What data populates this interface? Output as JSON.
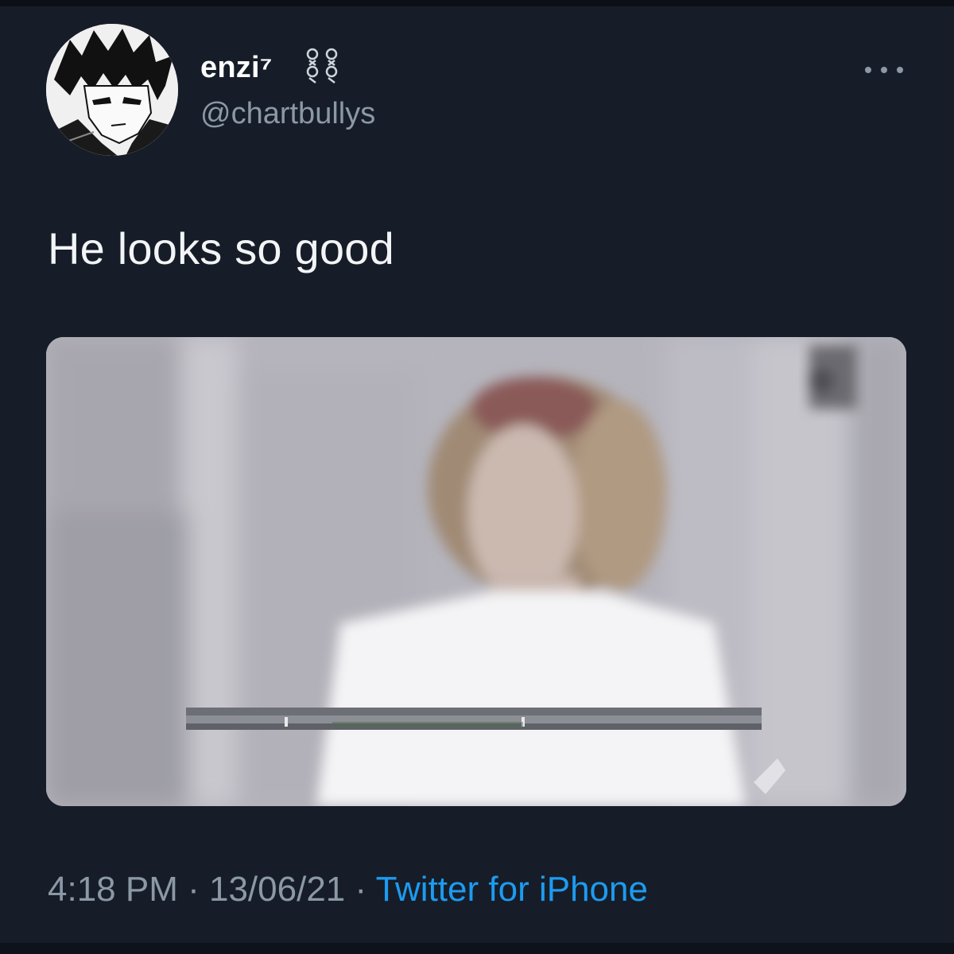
{
  "author": {
    "display_name": "enzi⁷",
    "handle": "@chartbullys",
    "avatar_icon": "anime-avatar",
    "name_badge_icon": "chain-icon"
  },
  "tweet": {
    "text": "He looks so good"
  },
  "media": {
    "kind": "video-thumbnail"
  },
  "meta": {
    "time": "4:18 PM",
    "separator": " · ",
    "date": "13/06/21",
    "source": "Twitter for iPhone"
  },
  "actions": {
    "more_icon": "more-icon"
  },
  "colors": {
    "background": "#161d28",
    "secondary_text": "#8b98a5",
    "link": "#1d9bf0"
  }
}
